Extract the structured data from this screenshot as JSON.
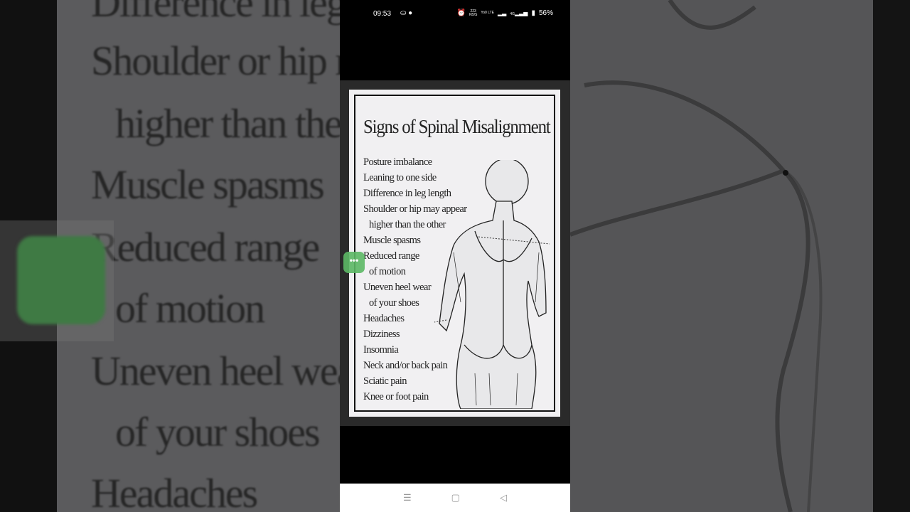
{
  "status_bar": {
    "time": "09:53",
    "net_speed": "223",
    "net_unit": "KB/S",
    "volte": "Yo0 LTE",
    "network": "4G",
    "battery": "56%"
  },
  "background_text": [
    "Difference in leg le",
    "Shoulder or hip ma",
    "higher than the o",
    "Muscle spasms",
    "Reduced range",
    "of motion",
    "Uneven heel wear",
    "of your shoes",
    "Headaches"
  ],
  "card": {
    "title": "Signs of Spinal Misalignment",
    "items": [
      {
        "text": "Posture imbalance",
        "indent": false
      },
      {
        "text": "Leaning to one side",
        "indent": false
      },
      {
        "text": "Difference in leg length",
        "indent": false
      },
      {
        "text": "Shoulder or hip may appear",
        "indent": false
      },
      {
        "text": "higher than the other",
        "indent": true
      },
      {
        "text": "Muscle spasms",
        "indent": false
      },
      {
        "text": "Reduced range",
        "indent": false
      },
      {
        "text": "of motion",
        "indent": true
      },
      {
        "text": "Uneven heel wear",
        "indent": false
      },
      {
        "text": "of your shoes",
        "indent": true
      },
      {
        "text": "Headaches",
        "indent": false
      },
      {
        "text": "Dizziness",
        "indent": false
      },
      {
        "text": "Insomnia",
        "indent": false
      },
      {
        "text": "Neck and/or back pain",
        "indent": false
      },
      {
        "text": "Sciatic pain",
        "indent": false
      },
      {
        "text": "Knee or foot pain",
        "indent": false
      }
    ]
  },
  "floating_button": {
    "label": "•••"
  },
  "nav": {
    "recents": "☰",
    "home": "▢",
    "back": "◁"
  }
}
